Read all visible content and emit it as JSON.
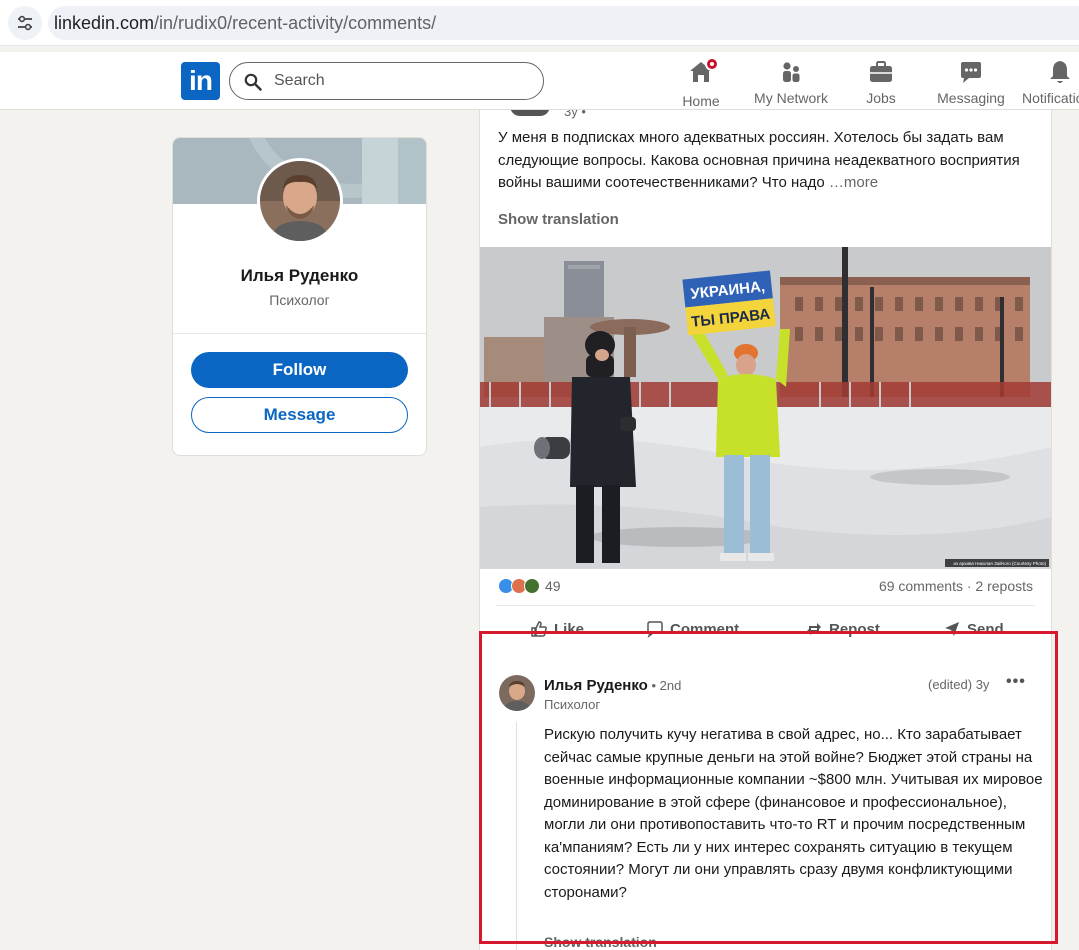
{
  "browser": {
    "url_host": "linkedin.com",
    "url_path": "/in/rudix0/recent-activity/comments/"
  },
  "nav": {
    "logo": "in",
    "search_placeholder": "Search",
    "items": [
      {
        "label": "Home",
        "icon": "home-icon",
        "badge": true
      },
      {
        "label": "My Network",
        "icon": "network-icon"
      },
      {
        "label": "Jobs",
        "icon": "briefcase-icon"
      },
      {
        "label": "Messaging",
        "icon": "messaging-icon"
      },
      {
        "label": "Notifications",
        "icon": "bell-icon"
      }
    ]
  },
  "profile": {
    "name": "Илья Руденко",
    "headline": "Психолог",
    "follow_label": "Follow",
    "message_label": "Message"
  },
  "post": {
    "meta": "3y • ",
    "text": "У меня в подписках много адекватных россиян. Хотелось бы задать вам следующие вопросы. Какова основная причина неадекватного восприятия войны вашими соотечественниками? Что надо ",
    "more_label": "…more",
    "show_translation": "Show translation",
    "image": {
      "sign_line1": "УКРАИНА,",
      "sign_line2": "ТЫ ПРАВА",
      "caption": "из архива Николая Зайчого (Courtesy Photo)"
    },
    "reaction_count": "49",
    "stats": "69 comments · 2 reposts",
    "actions": {
      "like": "Like",
      "comment": "Comment",
      "repost": "Repost",
      "send": "Send"
    }
  },
  "comment": {
    "author": "Илья Руденко",
    "degree": " • 2nd",
    "headline": "Психолог",
    "time": "(edited) 3y",
    "menu": "•••",
    "text": "Рискую получить кучу негатива в свой адрес, но... Кто зарабатывает сейчас самые крупные деньги на этой войне? Бюджет этой страны на военные информационные компании ~$800 млн. Учитывая их мировое доминирование в этой сфере (финансовое и профессиональное), могли ли они противопоставить что-то RT и прочим посредственным ка'мпаниям? Есть ли у них интерес сохранять ситуацию в текущем состоянии? Могут ли они управлять сразу двумя конфликтующими сторонами?",
    "show_translation": "Show translation"
  },
  "colors": {
    "brand": "#0a66c2",
    "highlight": "#d7192e",
    "background": "#f3f2ef"
  }
}
